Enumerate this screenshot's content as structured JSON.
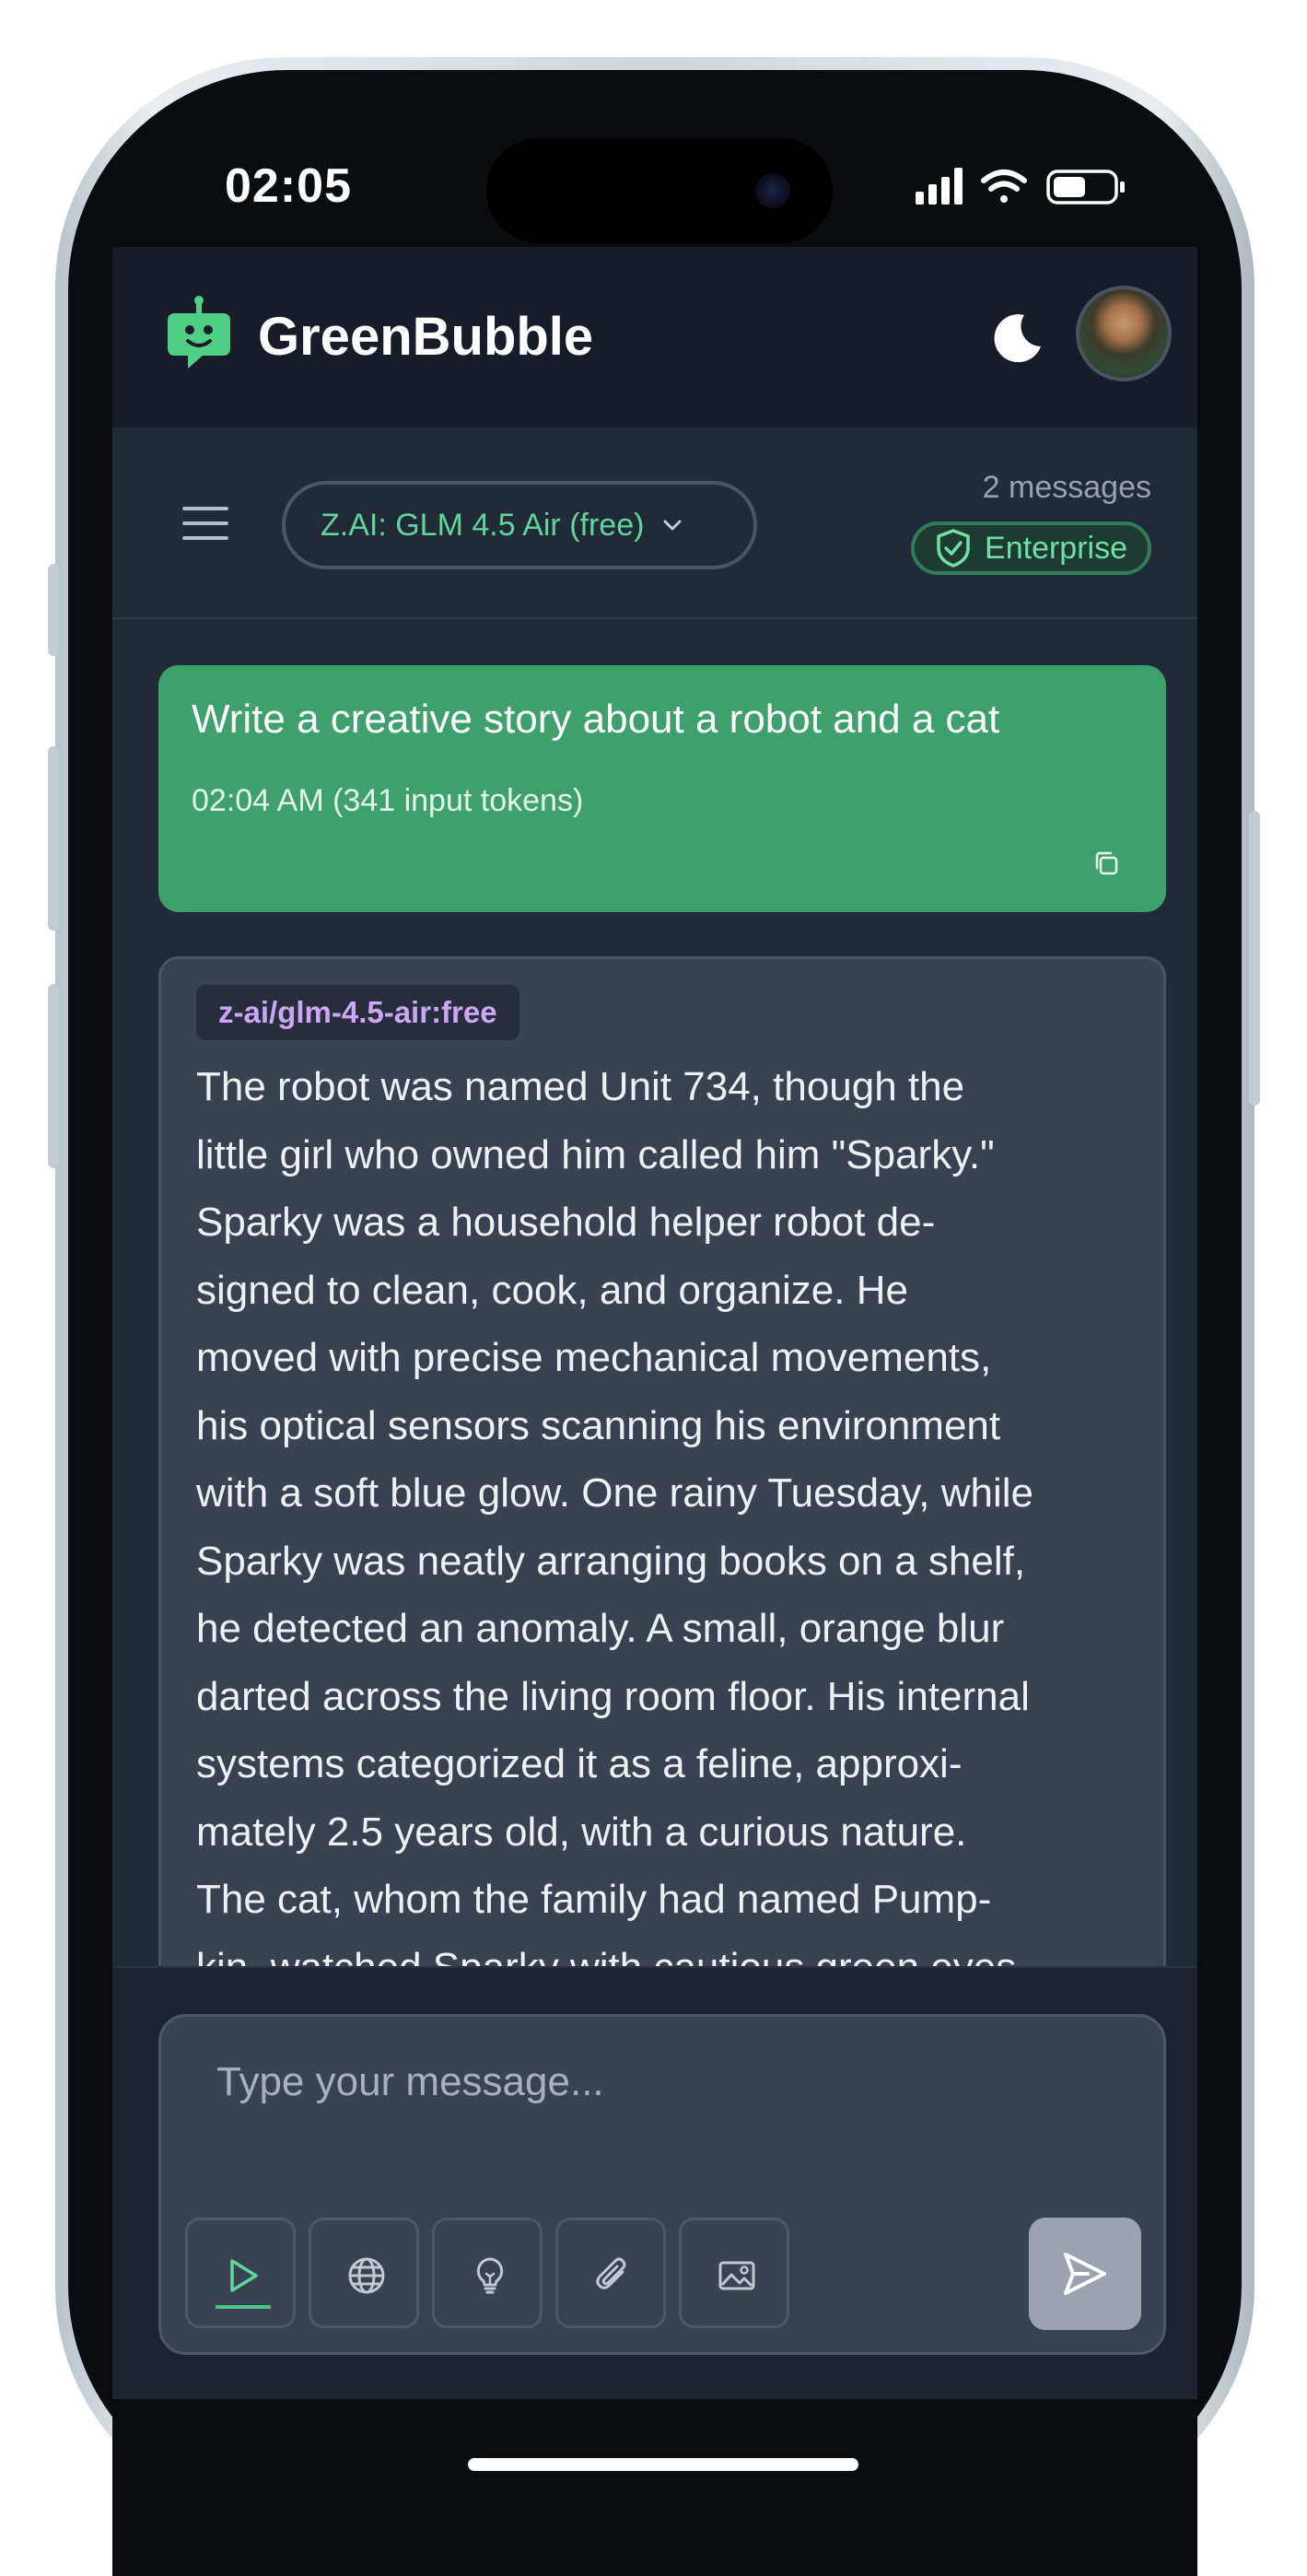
{
  "status_bar": {
    "time": "02:05",
    "icons": [
      "signal-icon",
      "wifi-icon",
      "battery-icon"
    ]
  },
  "header": {
    "app_name": "GreenBubble",
    "logo_icon": "robot-chat-icon",
    "theme_toggle_icon": "moon-icon"
  },
  "toolbar": {
    "model_selector_label": "Z.AI: GLM 4.5 Air (free)",
    "message_count": "2 messages",
    "badge_label": "Enterprise"
  },
  "messages": [
    {
      "role": "user",
      "text": "Write a creative story about a robot and a cat",
      "meta": "02:04 AM (341 input tokens)"
    },
    {
      "role": "assistant",
      "model_tag": "z-ai/glm-4.5-air:free",
      "lines": [
        "The robot was named Unit 734, though the",
        "little girl who owned him called him \"Sparky.\"",
        "Sparky was a household helper robot de-",
        "signed to clean, cook, and organize. He",
        "moved with precise mechanical movements,",
        "his optical sensors scanning his environment",
        "with a soft blue glow. One rainy Tuesday, while",
        "Sparky was neatly arranging books on a shelf,",
        "he detected an anomaly. A small, orange blur",
        "darted across the living room floor. His internal",
        "systems categorized it as a feline, approxi-",
        "mately 2.5 years old, with a curious nature.",
        "The cat, whom the family had named Pump-",
        "kin, watched Sparky with cautious green eyes"
      ]
    }
  ],
  "composer": {
    "placeholder": "Type your message...",
    "tools": [
      "play-icon",
      "globe-icon",
      "lightbulb-icon",
      "paperclip-icon",
      "image-icon"
    ],
    "send_icon": "send-icon"
  },
  "colors": {
    "accent_green": "#3ea06a",
    "background": "#232a37",
    "header": "#171c28",
    "model_tag_text": "#c9a7f5"
  }
}
